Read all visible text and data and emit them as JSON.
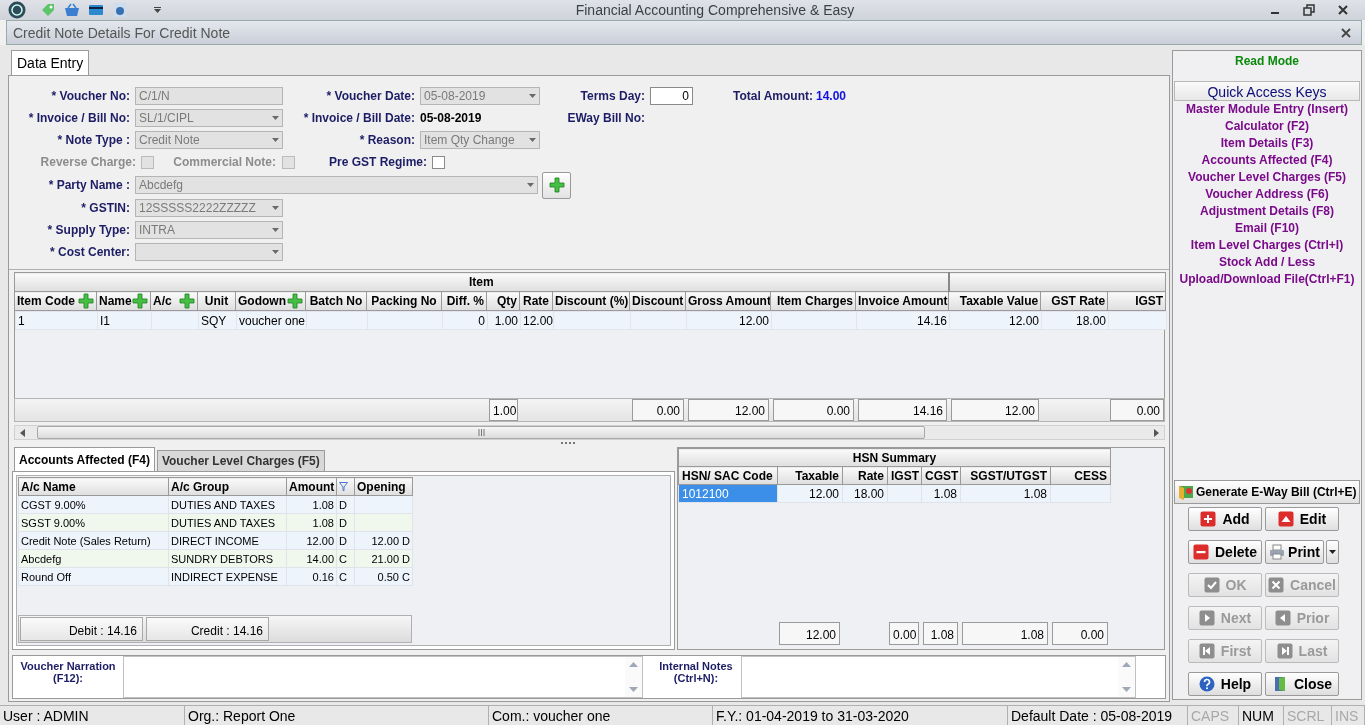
{
  "app": {
    "title": "Financial Accounting Comprehensive & Easy"
  },
  "window": {
    "title": "Credit Note Details For Credit Note"
  },
  "tabs": [
    {
      "label": "Data Entry",
      "selected": true
    }
  ],
  "form": {
    "rows": [
      {
        "kind": "normal",
        "fields": [
          {
            "kind": "text",
            "label": "* Voucher No:",
            "value": "C/1/N",
            "disabled": true
          },
          {
            "kind": "combo",
            "label": "* Voucher Date:",
            "value": "05-08-2019",
            "disabled": true
          },
          {
            "kind": "text",
            "label": "Terms Day:",
            "value": "0",
            "disabled": false
          },
          {
            "kind": "total",
            "label": "Total Amount:",
            "value": "14.00"
          }
        ]
      },
      {
        "kind": "normal",
        "fields": [
          {
            "kind": "combo",
            "label": "* Invoice / Bill No:",
            "value": "SL/1/CIPL",
            "disabled": true
          },
          {
            "kind": "static",
            "label": "* Invoice / Bill Date:",
            "value": "05-08-2019"
          },
          {
            "kind": "label",
            "label": "EWay Bill No:"
          }
        ]
      },
      {
        "kind": "normal",
        "fields": [
          {
            "kind": "combo",
            "label": "* Note Type :",
            "value": "Credit Note",
            "disabled": true
          },
          {
            "kind": "combo",
            "label": "* Reason:",
            "value": "Item Qty Change",
            "disabled": true
          }
        ]
      },
      {
        "kind": "checks",
        "fields": [
          {
            "kind": "check",
            "label": "Reverse Charge:",
            "checked": false,
            "disabled": true
          },
          {
            "kind": "check",
            "label": "Commercial Note:",
            "checked": false,
            "disabled": true
          },
          {
            "kind": "check",
            "label": "Pre GST Regime:",
            "checked": false,
            "disabled": false
          }
        ]
      },
      {
        "kind": "wide",
        "fields": [
          {
            "kind": "combo",
            "label": "* Party Name :",
            "value": "Abcdefg",
            "disabled": true
          }
        ]
      },
      {
        "kind": "normal",
        "fields": [
          {
            "kind": "combo",
            "label": "* GSTIN:",
            "value": "12SSSSS2222ZZZZZ",
            "disabled": true
          }
        ]
      },
      {
        "kind": "normal",
        "fields": [
          {
            "kind": "combo",
            "label": "* Supply Type:",
            "value": "INTRA",
            "disabled": true
          }
        ]
      },
      {
        "kind": "normal",
        "fields": [
          {
            "kind": "combo",
            "label": "* Cost Center:",
            "disabled": true
          }
        ]
      }
    ]
  },
  "item_grid": {
    "group_header": "Item",
    "columns": [
      {
        "label": "Item Code",
        "add": true,
        "values": [
          "1"
        ]
      },
      {
        "label": "Name",
        "add": true,
        "values": [
          "I1"
        ]
      },
      {
        "label": "A/c",
        "add": true
      },
      {
        "label": "Unit",
        "add": false,
        "values": [
          "SQY"
        ]
      },
      {
        "label": "Godown",
        "add": true,
        "values": [
          "voucher one"
        ]
      },
      {
        "label": "Batch No",
        "add": false
      },
      {
        "label": "Packing No",
        "add": false
      },
      {
        "label": "Diff. %",
        "add": false,
        "values": [
          "0"
        ]
      },
      {
        "label": "Qty",
        "add": false,
        "values": [
          "1.00"
        ],
        "total": "1.00"
      },
      {
        "label": "Rate",
        "add": false,
        "values": [
          "12.00"
        ]
      },
      {
        "label": "Discount (%)",
        "add": false
      },
      {
        "label": "Discount",
        "add": false,
        "total": "0.00"
      },
      {
        "label": "Gross Amount",
        "add": false,
        "values": [
          "12.00"
        ],
        "total": "12.00"
      },
      {
        "label": "Item Charges",
        "add": false,
        "total": "0.00"
      },
      {
        "label": "Invoice Amount",
        "add": false,
        "values": [
          "14.16"
        ],
        "total": "14.16"
      },
      {
        "label": "Taxable Value",
        "add": false,
        "values": [
          "12.00"
        ],
        "total": "12.00"
      },
      {
        "label": "GST Rate",
        "add": false,
        "values": [
          "18.00"
        ]
      },
      {
        "label": "IGST",
        "add": false,
        "total": "0.00"
      }
    ]
  },
  "accounts": {
    "tabs": [
      {
        "label": "Accounts Affected (F4)",
        "selected": true
      },
      {
        "label": "Voucher Level Charges (F5)",
        "selected": false
      }
    ],
    "columns": [
      {
        "kind": "text",
        "label": "A/c Name"
      },
      {
        "kind": "text",
        "label": "A/c Group"
      },
      {
        "kind": "text",
        "label": "Amount"
      },
      {
        "kind": "filter"
      },
      {
        "kind": "text",
        "label": "Opening"
      }
    ],
    "rows": [
      {
        "name": "CGST 9.00%",
        "group": "DUTIES AND TAXES",
        "amount": "1.08",
        "side": "D"
      },
      {
        "name": "SGST 9.00%",
        "group": "DUTIES AND TAXES",
        "amount": "1.08",
        "side": "D"
      },
      {
        "name": "Credit Note (Sales Return)",
        "group": "DIRECT INCOME",
        "amount": "12.00",
        "side": "D",
        "opening": "12.00 D"
      },
      {
        "name": "Abcdefg",
        "group": "SUNDRY DEBTORS",
        "amount": "14.00",
        "side": "C",
        "opening": "21.00 D"
      },
      {
        "name": "Round Off",
        "group": "INDIRECT EXPENSE",
        "amount": "0.16",
        "side": "C",
        "opening": "0.50 C"
      }
    ],
    "debit": "Debit : 14.16",
    "credit": "Credit : 14.16"
  },
  "hsn": {
    "title": "HSN Summary",
    "row_selection": [
      true
    ],
    "columns": [
      {
        "label": "HSN/ SAC Code",
        "values": [
          "1012100"
        ]
      },
      {
        "label": "Taxable",
        "values": [
          "12.00"
        ],
        "total": "12.00"
      },
      {
        "label": "Rate",
        "values": [
          "18.00"
        ]
      },
      {
        "label": "IGST",
        "total": "0.00"
      },
      {
        "label": "CGST",
        "values": [
          "1.08"
        ],
        "total": "1.08"
      },
      {
        "label": "SGST/UTGST",
        "values": [
          "1.08"
        ],
        "total": "1.08"
      },
      {
        "label": "CESS",
        "total": "0.00"
      }
    ]
  },
  "narration": {
    "fields": [
      {
        "label": "Voucher Narration (F12):"
      },
      {
        "label": "Internal Notes (Ctrl+N):"
      }
    ]
  },
  "side_panel": {
    "mode": "Read Mode",
    "quick_access": {
      "title": "Quick Access Keys",
      "items": [
        "Master Module Entry (Insert)",
        "Calculator (F2)",
        "Item Details (F3)",
        "Accounts Affected (F4)",
        "Voucher Level Charges (F5)",
        "Voucher Address (F6)",
        "Adjustment Details (F8)",
        "Email (F10)",
        "Item Level Charges (Ctrl+I)",
        "Stock Add / Less",
        "Upload/Download File(Ctrl+F1)"
      ]
    },
    "eway_button": "Generate E-Way Bill (Ctrl+E)",
    "buttons": [
      {
        "kind": "add",
        "label": "Add",
        "disabled": false
      },
      {
        "kind": "edit",
        "label": "Edit",
        "disabled": false
      },
      {
        "kind": "delete",
        "label": "Delete",
        "disabled": false
      },
      {
        "kind": "print",
        "label": "Print",
        "disabled": false
      },
      {
        "kind": "ok",
        "label": "OK",
        "disabled": true
      },
      {
        "kind": "cancel",
        "label": "Cancel",
        "disabled": true
      },
      {
        "kind": "next",
        "label": "Next",
        "disabled": true
      },
      {
        "kind": "prior",
        "label": "Prior",
        "disabled": true
      },
      {
        "kind": "first",
        "label": "First",
        "disabled": true
      },
      {
        "kind": "last",
        "label": "Last",
        "disabled": true
      },
      {
        "kind": "help",
        "label": "Help",
        "disabled": false
      },
      {
        "kind": "close",
        "label": "Close",
        "disabled": false
      }
    ]
  },
  "status_bar": {
    "segments": [
      "User : ADMIN",
      "Org.: Report One",
      "Com.: voucher one",
      "F.Y.: 01-04-2019 to 31-03-2020",
      "Default Date : 05-08-2019"
    ],
    "indicators": [
      {
        "label": "CAPS",
        "on": false
      },
      {
        "label": "NUM",
        "on": true
      },
      {
        "label": "SCRL",
        "on": false
      },
      {
        "label": "INS",
        "on": false
      }
    ]
  }
}
